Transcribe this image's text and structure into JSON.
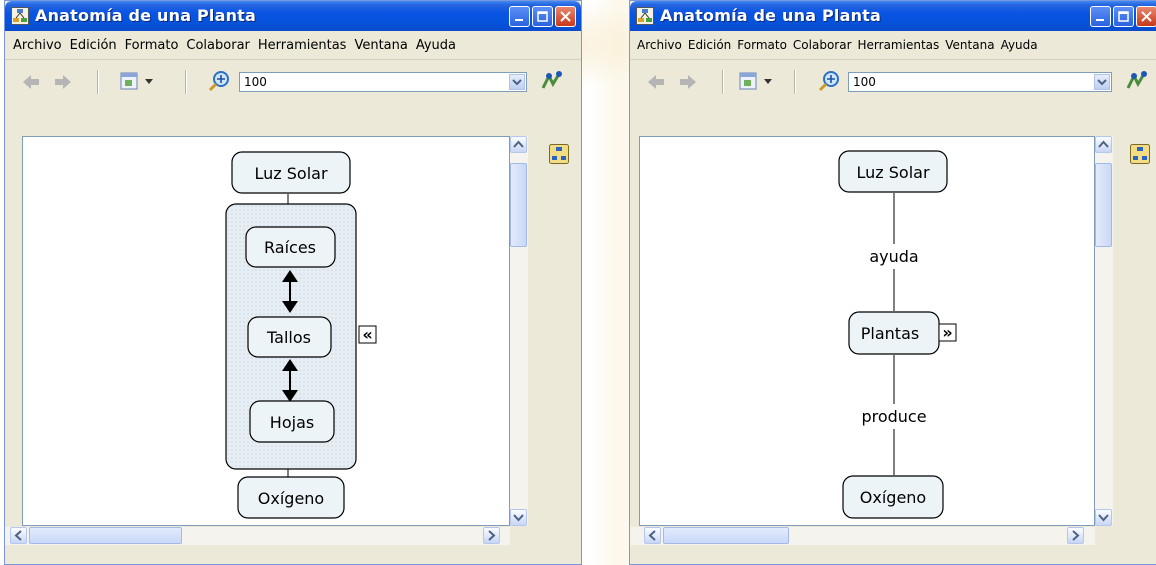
{
  "left_window": {
    "title": "Anatomía de una Planta",
    "menu": [
      "Archivo",
      "Edición",
      "Formato",
      "Colaborar",
      "Herramientas",
      "Ventana",
      "Ayuda"
    ],
    "zoom_value": "100",
    "nodes": {
      "luz_solar": "Luz Solar",
      "raices": "Raíces",
      "tallos": "Tallos",
      "hojas": "Hojas",
      "oxigeno": "Oxígeno"
    },
    "collapse_glyph": "«"
  },
  "right_window": {
    "title": "Anatomía de una Planta",
    "menu": [
      "Archivo",
      "Edición",
      "Formato",
      "Colaborar",
      "Herramientas",
      "Ventana",
      "Ayuda"
    ],
    "zoom_value": "100",
    "nodes": {
      "luz_solar": "Luz Solar",
      "plantas": "Plantas",
      "oxigeno": "Oxígeno"
    },
    "links": {
      "ayuda": "ayuda",
      "produce": "produce"
    },
    "expand_glyph": "»"
  },
  "icons": [
    "app-icon",
    "minimize-icon",
    "maximize-icon",
    "close-icon",
    "back-arrow-icon",
    "forward-arrow-icon",
    "view-icon",
    "zoom-icon",
    "chevron-down-icon",
    "cmap-tools-icon",
    "scroll-up-icon",
    "scroll-down-icon",
    "scroll-left-icon",
    "scroll-right-icon"
  ],
  "colors": {
    "titlebar": "#0553dc",
    "close_button": "#c7391b",
    "node_fill": "#edf4f8",
    "window_bg": "#ece9d8"
  }
}
